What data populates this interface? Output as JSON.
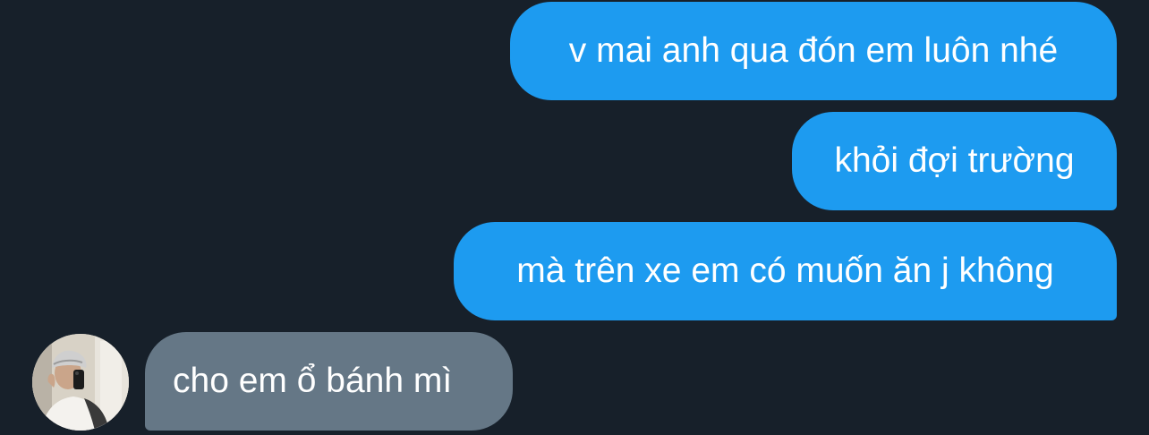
{
  "conversation": {
    "messages": [
      {
        "direction": "sent",
        "text": "v mai anh qua đón em luôn nhé"
      },
      {
        "direction": "sent",
        "text": "khỏi đợi trường"
      },
      {
        "direction": "sent",
        "text": "mà trên xe em có muốn ăn j không"
      },
      {
        "direction": "received",
        "text": "cho em ổ bánh mì"
      }
    ],
    "avatar": {
      "icon": "user-avatar-photo"
    }
  },
  "colors": {
    "background": "#17202a",
    "sent_bubble": "#1d9bf0",
    "received_bubble": "#657786",
    "text": "#ffffff"
  }
}
